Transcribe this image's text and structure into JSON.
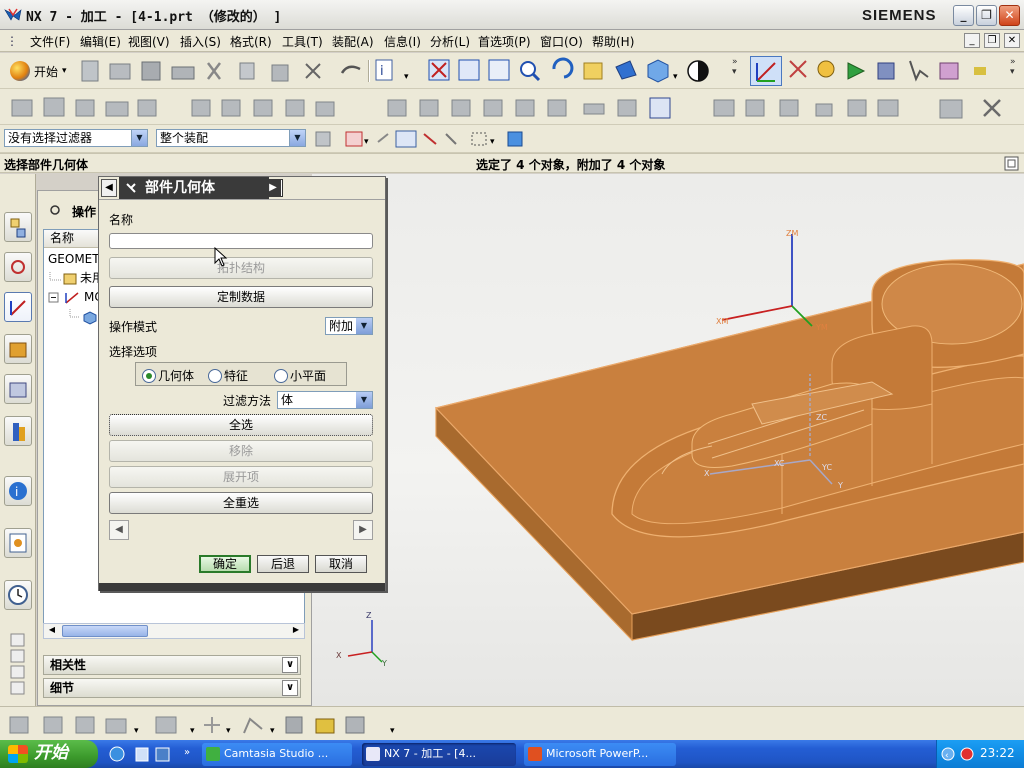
{
  "window": {
    "title": "NX 7 - 加工 - [4-1.prt （修改的） ]",
    "brand": "SIEMENS",
    "controls": {
      "minimize": "_",
      "restore": "❐",
      "close": "✕"
    }
  },
  "menubar": {
    "items": [
      "文件(F)",
      "编辑(E)",
      "视图(V)",
      "插入(S)",
      "格式(R)",
      "工具(T)",
      "装配(A)",
      "信息(I)",
      "分析(L)",
      "首选项(P)",
      "窗口(O)",
      "帮助(H)"
    ],
    "mdi_controls": [
      "_",
      "❐",
      "✕"
    ]
  },
  "toolbar1": {
    "start_label": "开始",
    "start_arrow": "▾"
  },
  "selection_bar": {
    "filter_value": "没有选择过滤器",
    "scope_value": "整个装配"
  },
  "cue": {
    "prompt": "选择部件几何体",
    "status": "选定了 4 个对象，附加了 4 个对象"
  },
  "navigator": {
    "title": "操作",
    "column_name": "名称",
    "rows": [
      "GEOMETI",
      "未用",
      "MC",
      ""
    ],
    "accordions": [
      "相关性",
      "细节"
    ]
  },
  "dialog": {
    "title": "部件几何体",
    "name_label": "名称",
    "topology_button": "拓扑结构",
    "custom_data_button": "定制数据",
    "op_mode_label": "操作模式",
    "op_mode_value": "附加",
    "selection_options_label": "选择选项",
    "radio_options": [
      "几何体",
      "特征",
      "小平面"
    ],
    "radio_selected": "几何体",
    "filter_method_label": "过滤方法",
    "filter_method_value": "体",
    "select_all_button": "全选",
    "remove_button": "移除",
    "expand_button": "展开项",
    "reselect_all_button": "全重选",
    "ok": "确定",
    "back": "后退",
    "cancel": "取消"
  },
  "graphics": {
    "triad_labels": {
      "x": "X",
      "y": "Y",
      "z": "Z",
      "xm": "XM",
      "ym": "YM",
      "zm": "ZM",
      "xc": "XC",
      "yc": "YC",
      "zc": "ZC"
    },
    "model_color": "#c9803e"
  },
  "taskbar": {
    "start": "开始",
    "tasks": [
      "Camtasia Studio ...",
      "NX 7 - 加工 - [4...",
      "Microsoft PowerP..."
    ],
    "clock": "23:22"
  }
}
